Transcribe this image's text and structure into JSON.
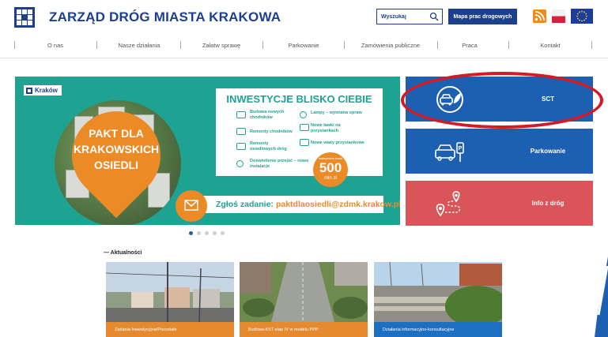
{
  "header": {
    "title": "ZARZĄD DRÓG MIASTA KRAKOWA",
    "search_placeholder": "Wyszukaj",
    "map_button": "Mapa prac drogowych",
    "icons": [
      "krakow-logo-icon",
      "rss-icon",
      "polish-flag-icon",
      "eu-flag-icon",
      "search-icon"
    ],
    "colors": {
      "brand": "#1d3f8f",
      "rss": "#f08a1c"
    }
  },
  "nav": {
    "items": [
      "O nas",
      "Nasze działania",
      "Załatw sprawę",
      "Parkowanie",
      "Zamówienia publiczne",
      "Praca",
      "Kontakt"
    ]
  },
  "banner": {
    "city_label": "Kraków",
    "pakt_lines": [
      "PAKT DLA",
      "KRAKOWSKICH",
      "OSIEDLI"
    ],
    "box_title": "INWESTYCJE BLISKO CIEBIE",
    "items": [
      "Budowa nowych chodników",
      "Lampy – wymiana opraw",
      "Remonty chodników",
      "Nowe ławki na przystankach",
      "Remonty osiedlowych dróg",
      "Nowe wiaty przystankowe",
      "Doświetlenie przejść – nowe instalacje"
    ],
    "badge": {
      "small": "maksymalna kwota",
      "amount": "500",
      "unit": "mln zł"
    },
    "report_label": "Zgłoś zadanie:",
    "report_email": "paktdlaosiedli@zdmk.krakow.pl",
    "colors": {
      "teal": "#1ea392",
      "orange": "#ec8a26"
    }
  },
  "carousel": {
    "dot_count": 5,
    "active_index": 0
  },
  "tiles": [
    {
      "label": "SCT",
      "icon": "eco-car-icon",
      "color": "#1d5fb0"
    },
    {
      "label": "Parkowanie",
      "icon": "parking-meter-icon",
      "color": "#1d5fb0"
    },
    {
      "label": "Info z dróg",
      "icon": "route-pin-icon",
      "color": "#d9555a"
    }
  ],
  "highlight": {
    "color": "#d41a22"
  },
  "news": {
    "heading": "— Aktualności",
    "items": [
      {
        "caption": "Zadania Inwestycyjne/Pozostałe",
        "color": "#e58a2e"
      },
      {
        "caption": "Budowa KST etap IV w modelu PPP",
        "color": "#e58a2e"
      },
      {
        "caption": "Działania informacyjno-konsultacyjne",
        "color": "#1d6fc2"
      }
    ]
  }
}
